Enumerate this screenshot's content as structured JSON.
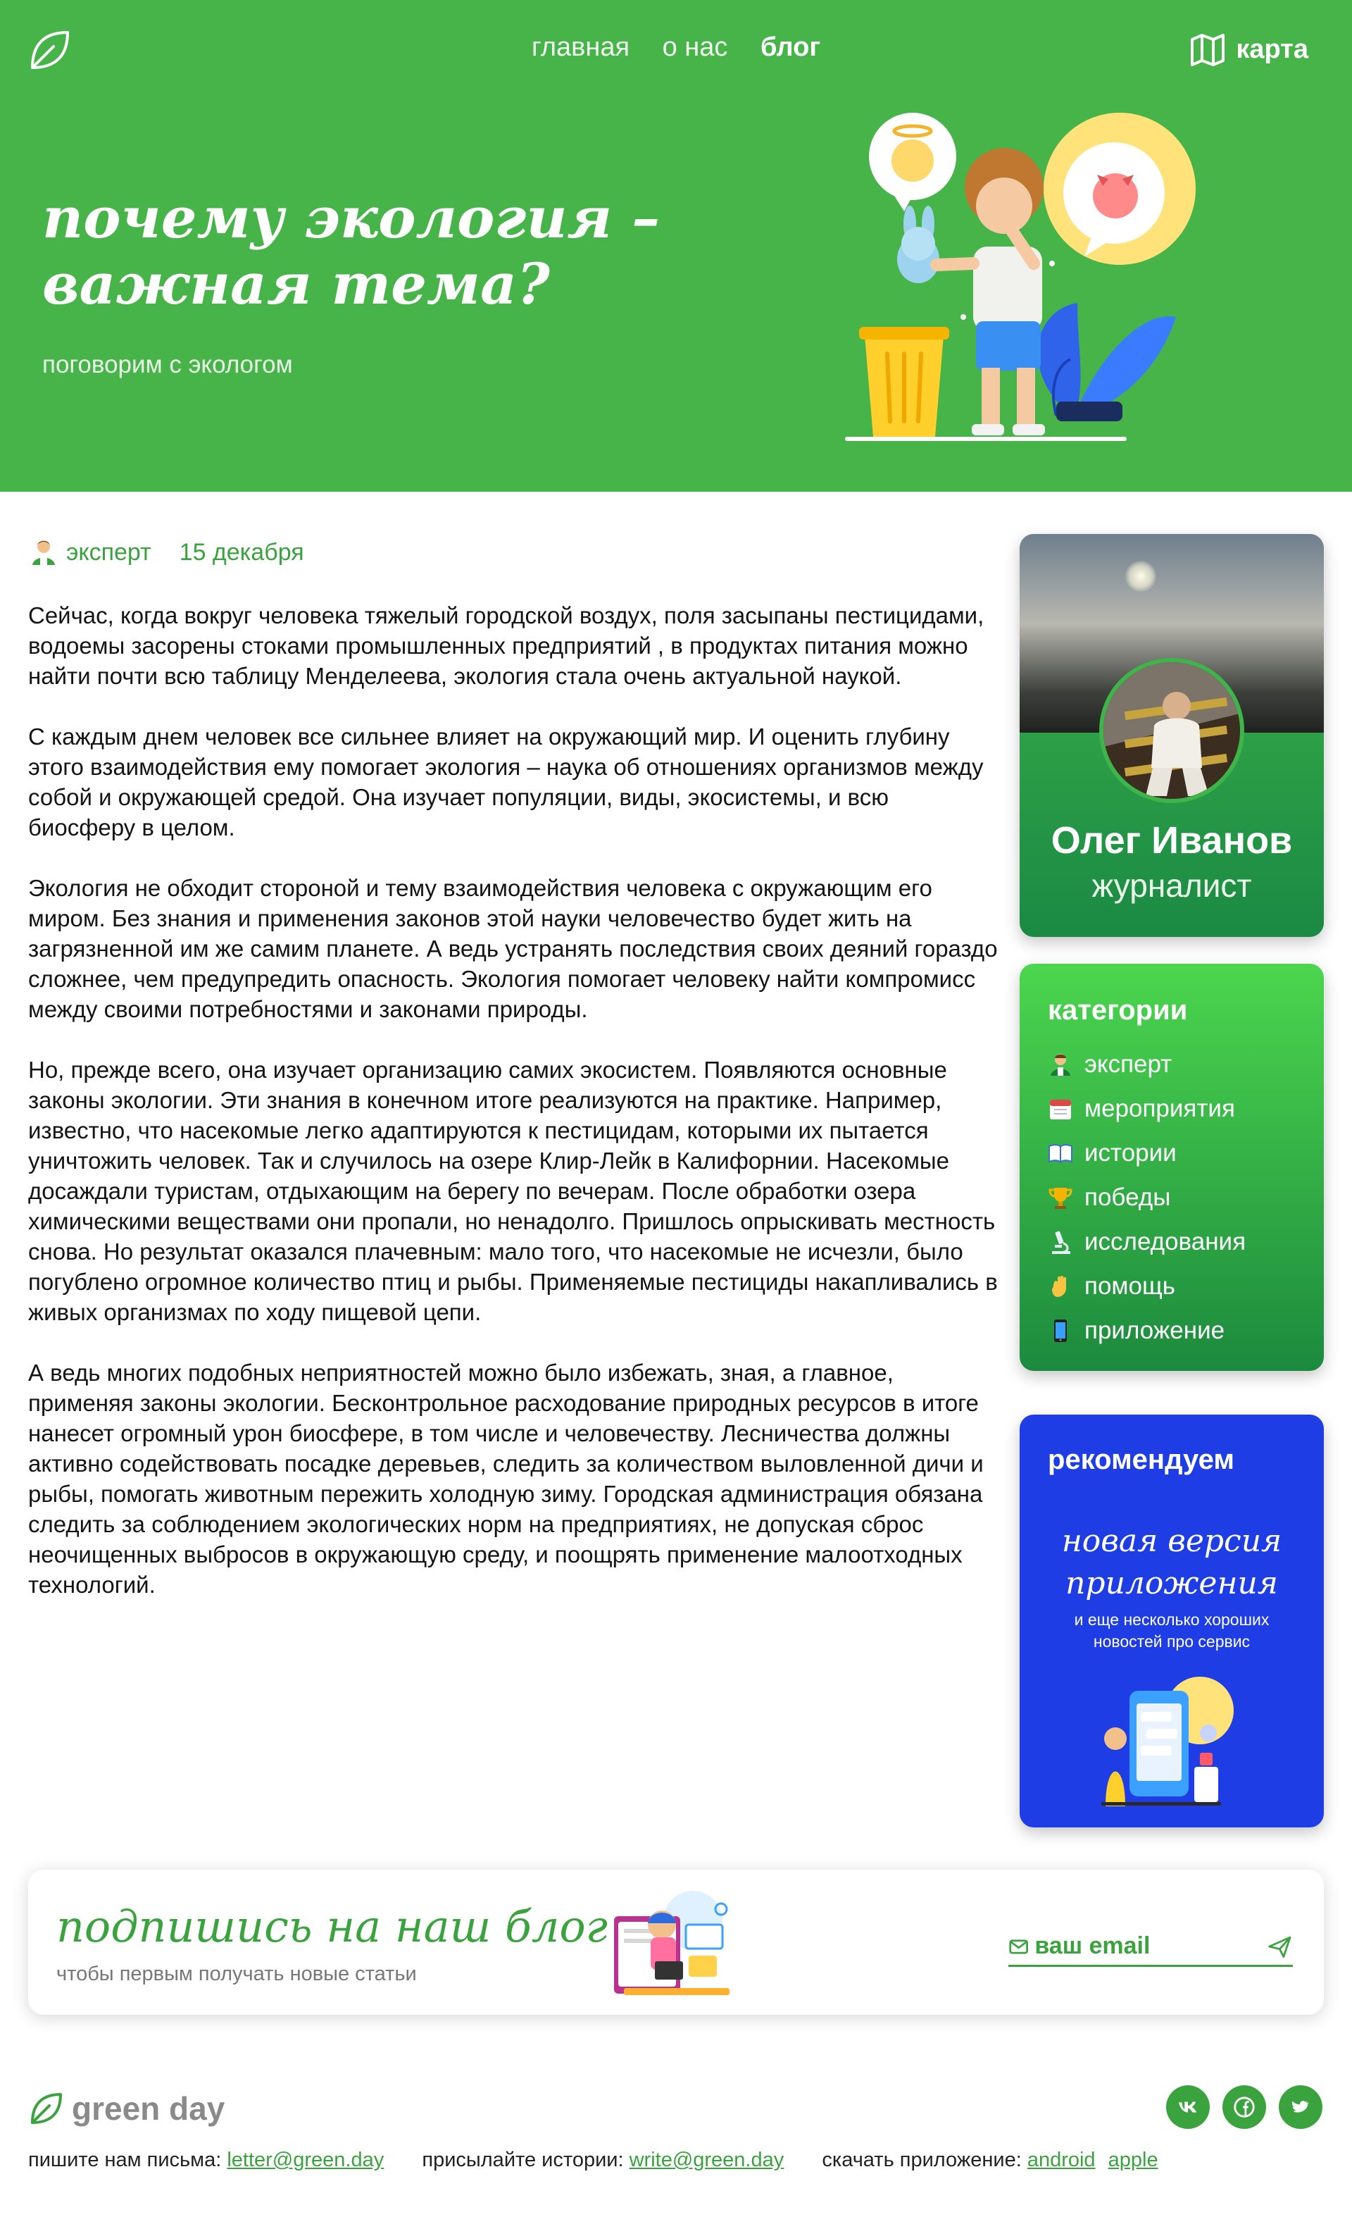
{
  "header": {
    "nav": [
      {
        "label": "главная",
        "active": false
      },
      {
        "label": "о нас",
        "active": false
      },
      {
        "label": "блог",
        "active": true
      }
    ],
    "map_label": "карта",
    "map_icon": "map-icon",
    "logo_icon": "leaf-icon"
  },
  "hero": {
    "title": "почему экология – важная тема?",
    "subtitle": "поговорим с экологом"
  },
  "article": {
    "category": "эксперт",
    "category_icon": "expert-icon",
    "date": "15 декабря",
    "paragraphs": [
      "Сейчас, когда вокруг человека тяжелый городской воздух, поля засыпаны пестицидами, водоемы засорены стоками промышленных предприятий , в продуктах питания можно найти почти всю таблицу Менделеева, экология стала очень актуальной наукой.",
      "С каждым днем человек все сильнее влияет на окружающий мир. И оценить глубину этого взаимодействия ему помогает экология – наука об отношениях организмов между собой и окружающей средой. Она изучает популяции, виды, экосистемы, и всю биосферу в целом.",
      "Экология не обходит стороной и тему взаимодействия человека с окружающим его миром. Без знания и применения законов этой науки человечество будет жить на загрязненной им же самим планете. А ведь устранять последствия своих деяний гораздо сложнее, чем предупредить опасность. Экология помогает человеку найти компромисс между своими потребностями и законами природы.",
      "Но, прежде всего, она изучает организацию самих экосистем. Появляются основные законы экологии. Эти знания в конечном итоге реализуются на практике. Например, известно, что насекомые легко адаптируются к пестицидам, которыми их пытается уничтожить человек. Так и случилось на озере Клир-Лейк в Калифорнии. Насекомые досаждали туристам, отдыхающим на берегу по вечерам. После обработки озера химическими веществами они пропали, но ненадолго. Пришлось опрыскивать местность снова. Но результат оказался плачевным: мало того, что насекомые не исчезли, было погублено огромное количество птиц и рыбы. Применяемые пестициды накапливались в живых организмах по ходу пищевой цепи.",
      "А ведь многих подобных неприятностей можно было избежать, зная, а главное, применяя законы экологии. Бесконтрольное расходование природных ресурсов в итоге нанесет огромный урон биосфере, в том числе и человечеству. Лесничества должны активно содействовать посадке деревьев, следить за количеством выловленной дичи и рыбы, помогать животным пережить холодную зиму. Городская администрация обязана следить за соблюдением экологических норм на предприятиях, не допуская сброс неочищенных выбросов в окружающую среду, и поощрять применение малоотходных технологий."
    ]
  },
  "author": {
    "name": "Олег Иванов",
    "role": "журналист"
  },
  "categories": {
    "title": "категории",
    "items": [
      {
        "label": "эксперт",
        "icon": "expert-icon"
      },
      {
        "label": "мероприятия",
        "icon": "calendar-icon"
      },
      {
        "label": "истории",
        "icon": "book-icon"
      },
      {
        "label": "победы",
        "icon": "trophy-icon"
      },
      {
        "label": "исследования",
        "icon": "microscope-icon"
      },
      {
        "label": "помощь",
        "icon": "hand-icon"
      },
      {
        "label": "приложение",
        "icon": "phone-icon"
      }
    ]
  },
  "recommend": {
    "title": "рекомендуем",
    "headline": "новая версия приложения",
    "text": "и еще несколько хороших новостей про сервис"
  },
  "subscribe": {
    "title": "подпишись на наш блог",
    "subtitle": "чтобы первым получать новые статьи",
    "email_placeholder": "ваш email"
  },
  "footer": {
    "brand": "green day",
    "write_label": "пишите нам письма:",
    "write_email": "letter@green.day",
    "stories_label": "присылайте истории:",
    "stories_email": "write@green.day",
    "app_label": "скачать приложение:",
    "android": "android",
    "apple": "apple",
    "social": [
      "vk-icon",
      "facebook-icon",
      "twitter-icon"
    ]
  },
  "colors": {
    "primary_green": "#46b448",
    "accent_green": "#3aa33e",
    "recommend_blue": "#1e3de4"
  }
}
